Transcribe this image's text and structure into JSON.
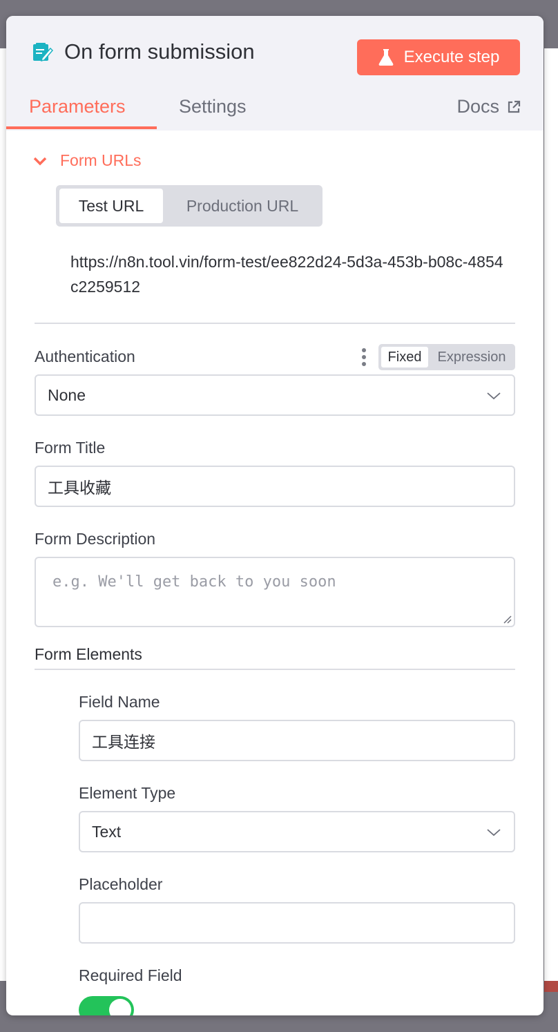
{
  "panel": {
    "title": "On form submission",
    "execute_label": "Execute step",
    "tabs": {
      "parameters": "Parameters",
      "settings": "Settings",
      "docs": "Docs"
    }
  },
  "form_urls": {
    "title": "Form URLs",
    "options": [
      "Test URL",
      "Production URL"
    ],
    "selected": "Test URL",
    "url": "https://n8n.tool.vin/form-test/ee822d24-5d3a-453b-b08c-4854c2259512"
  },
  "authentication": {
    "label": "Authentication",
    "mode_options": [
      "Fixed",
      "Expression"
    ],
    "mode_selected": "Fixed",
    "value": "None"
  },
  "form_title": {
    "label": "Form Title",
    "value": "工具收藏"
  },
  "form_description": {
    "label": "Form Description",
    "placeholder": "e.g. We'll get back to you soon"
  },
  "form_elements": {
    "title": "Form Elements",
    "field_name": {
      "label": "Field Name",
      "value": "工具连接"
    },
    "element_type": {
      "label": "Element Type",
      "value": "Text"
    },
    "placeholder": {
      "label": "Placeholder",
      "value": ""
    },
    "required_field": {
      "label": "Required Field",
      "value": true
    }
  },
  "colors": {
    "accent": "#ff6d5a",
    "toggle_on": "#23c35a",
    "icon": "#1cb3c2"
  }
}
